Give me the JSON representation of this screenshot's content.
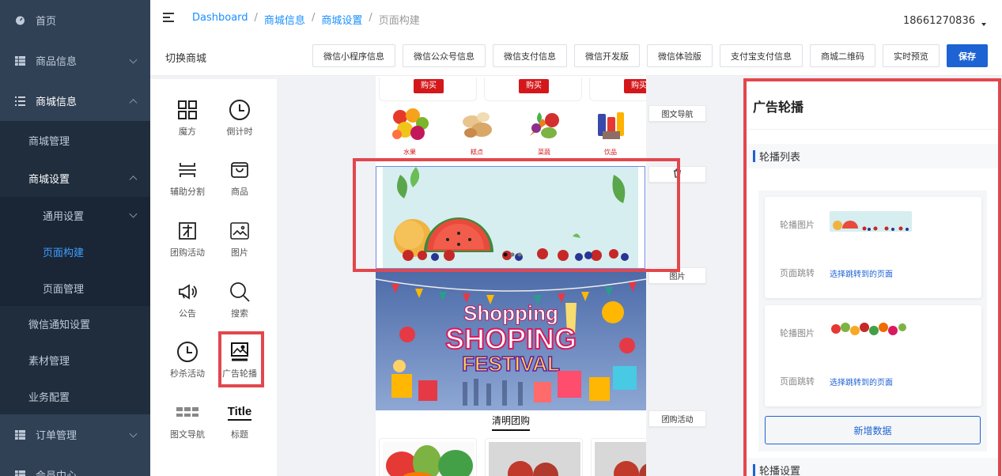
{
  "sidebar": {
    "items": [
      {
        "label": "首页",
        "icon": "dashboard-icon"
      },
      {
        "label": "商品信息",
        "icon": "grid-icon"
      },
      {
        "label": "商城信息",
        "icon": "list-icon"
      }
    ],
    "sub": [
      {
        "label": "商城管理"
      },
      {
        "label": "商城设置"
      }
    ],
    "sub3": [
      {
        "label": "通用设置"
      },
      {
        "label": "页面构建"
      },
      {
        "label": "页面管理"
      }
    ],
    "sub_after": [
      {
        "label": "微信通知设置"
      },
      {
        "label": "素材管理"
      },
      {
        "label": "业务配置"
      }
    ],
    "bottom": [
      {
        "label": "订单管理",
        "icon": "grid-icon"
      },
      {
        "label": "会员中心",
        "icon": "grid-icon"
      }
    ]
  },
  "header": {
    "breadcrumb": [
      "Dashboard",
      "商城信息",
      "商城设置",
      "页面构建"
    ],
    "sep": "/",
    "user": "18661270836"
  },
  "toolbar": {
    "title": "切换商城",
    "buttons": [
      "微信小程序信息",
      "微信公众号信息",
      "微信支付信息",
      "微信开发版",
      "微信体验版",
      "支付宝支付信息",
      "商城二维码",
      "实时预览"
    ],
    "save": "保存"
  },
  "components": [
    {
      "label": "魔方",
      "icon": "cube-grid-icon"
    },
    {
      "label": "倒计时",
      "icon": "clock-icon"
    },
    {
      "label": "辅助分割",
      "icon": "divider-icon"
    },
    {
      "label": "商品",
      "icon": "shopping-bag-icon"
    },
    {
      "label": "团购活动",
      "icon": "group-buy-icon"
    },
    {
      "label": "图片",
      "icon": "image-icon"
    },
    {
      "label": "公告",
      "icon": "megaphone-icon"
    },
    {
      "label": "搜索",
      "icon": "search-icon"
    },
    {
      "label": "秒杀活动",
      "icon": "flash-sale-clock-icon"
    },
    {
      "label": "广告轮播",
      "icon": "carousel-image-icon"
    },
    {
      "label": "图文导航",
      "icon": "nav-icon"
    },
    {
      "label": "标题",
      "icon": "title-icon",
      "glyph": "Title"
    }
  ],
  "preview": {
    "buy_label": "购买",
    "nav": [
      "水果",
      "糕点",
      "菜蔬",
      "饮品"
    ],
    "banner_text": {
      "line1": "Shopping",
      "line2": "SHOPING",
      "line3": "FESTIVAL"
    },
    "group_title": "清明团购"
  },
  "tags": {
    "nav": "图文导航",
    "image": "图片",
    "group": "团购活动"
  },
  "right_panel": {
    "title": "广告轮播",
    "list_section": "轮播列表",
    "image_label": "轮播图片",
    "jump_label": "页面跳转",
    "jump_link": "选择跳转到的页面",
    "add": "新增数据",
    "settings_section": "轮播设置"
  },
  "colors": {
    "sidebar": "#304156",
    "primary": "#1d63d3",
    "highlight": "#e2474d",
    "buy": "#d4171b"
  }
}
